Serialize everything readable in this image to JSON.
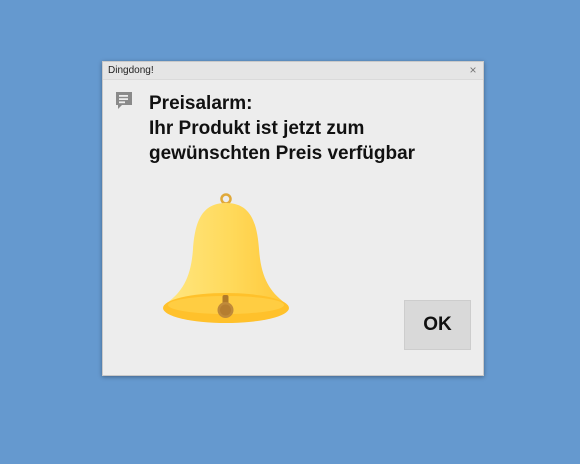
{
  "dialog": {
    "title": "Dingdong!",
    "close_glyph": "×",
    "message": {
      "line1": "Preisalarm:",
      "line2": "Ihr Produkt ist jetzt zum",
      "line3": "gewünschten Preis verfügbar"
    },
    "ok_label": "OK"
  },
  "icons": {
    "message": "message-icon",
    "bell": "bell-icon",
    "close": "close-icon"
  },
  "colors": {
    "desktop_background": "#6599cf",
    "dialog_background": "#ededed",
    "bell_light": "#ffe27a",
    "bell_dark": "#ffc83a",
    "button_background": "#d9d9d9"
  }
}
